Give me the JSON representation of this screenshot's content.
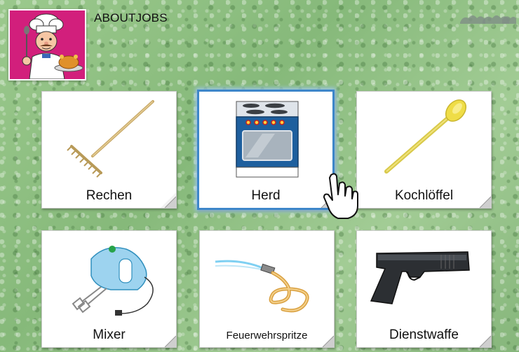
{
  "app": {
    "title": "ABOUTJOBS",
    "logo": "chef-logo-icon",
    "accent_color": "#d21f7c",
    "selection_color": "#3d86c9"
  },
  "cards": [
    {
      "label": "Rechen",
      "icon": "rake-icon",
      "selected": false
    },
    {
      "label": "Herd",
      "icon": "stove-icon",
      "selected": true
    },
    {
      "label": "Kochlöffel",
      "icon": "wooden-spoon-icon",
      "selected": false
    },
    {
      "label": "Mixer",
      "icon": "hand-mixer-icon",
      "selected": false
    },
    {
      "label": "Feuerwehrspritze",
      "icon": "fire-hose-icon",
      "selected": false
    },
    {
      "label": "Dienstwaffe",
      "icon": "pistol-icon",
      "selected": false
    }
  ],
  "cursor": "hand-pointer-icon"
}
